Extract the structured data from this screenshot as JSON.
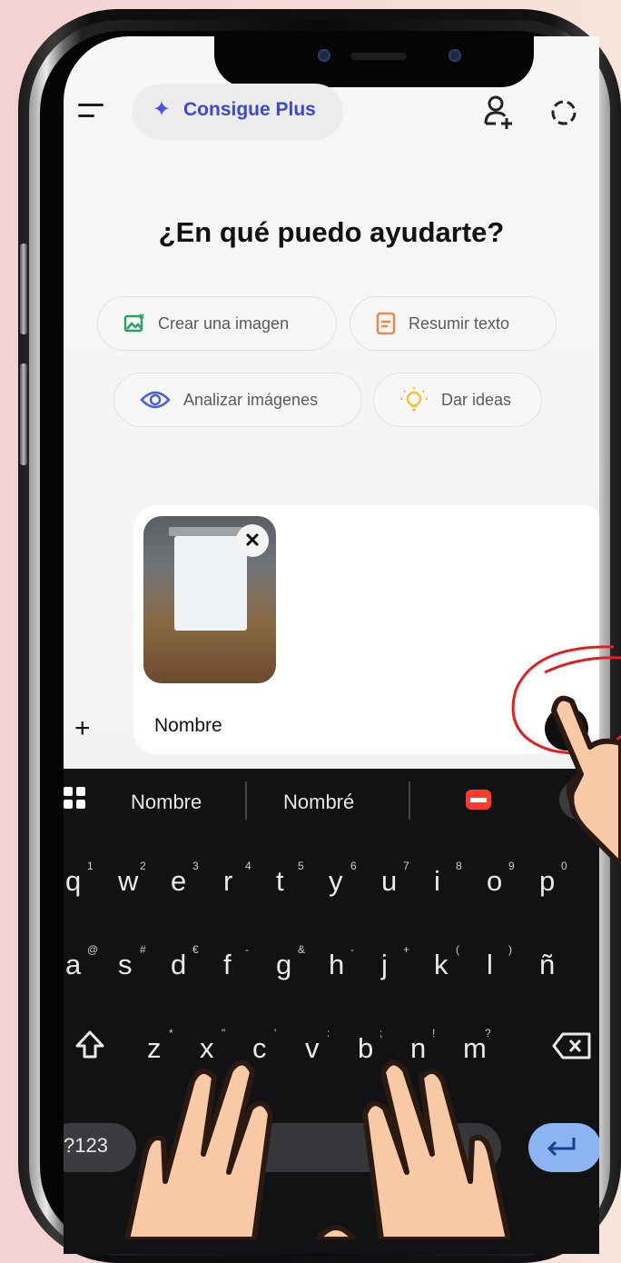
{
  "header": {
    "plus_label": "Consigue Plus",
    "icons": [
      "menu-icon",
      "add-person-icon",
      "dotted-circle-icon"
    ]
  },
  "main": {
    "title": "¿En qué puedo ayudarte?",
    "chips": [
      {
        "label": "Crear una imagen",
        "icon": "image-icon",
        "color": "#2aa06a"
      },
      {
        "label": "Resumir texto",
        "icon": "document-icon",
        "color": "#e8894a"
      },
      {
        "label": "Analizar imágenes",
        "icon": "eye-icon",
        "color": "#4b5fd6"
      },
      {
        "label": "Dar ideas",
        "icon": "lightbulb-icon",
        "color": "#e9c93c"
      }
    ]
  },
  "composer": {
    "text": "Nombre"
  },
  "keyboard": {
    "suggestions": [
      "Nombre",
      "Nombré"
    ],
    "row1": [
      {
        "k": "q",
        "h": "1"
      },
      {
        "k": "w",
        "h": "2"
      },
      {
        "k": "e",
        "h": "3"
      },
      {
        "k": "r",
        "h": "4"
      },
      {
        "k": "t",
        "h": "5"
      },
      {
        "k": "y",
        "h": "6"
      },
      {
        "k": "u",
        "h": "7"
      },
      {
        "k": "i",
        "h": "8"
      },
      {
        "k": "o",
        "h": "9"
      },
      {
        "k": "p",
        "h": "0"
      }
    ],
    "row2": [
      {
        "k": "a",
        "h": "@"
      },
      {
        "k": "s",
        "h": "#"
      },
      {
        "k": "d",
        "h": "€"
      },
      {
        "k": "f",
        "h": "-"
      },
      {
        "k": "g",
        "h": "&"
      },
      {
        "k": "h",
        "h": "-"
      },
      {
        "k": "j",
        "h": "+"
      },
      {
        "k": "k",
        "h": "("
      },
      {
        "k": "l",
        "h": ")"
      },
      {
        "k": "ñ",
        "h": ""
      }
    ],
    "row3": [
      {
        "k": "z",
        "h": "*"
      },
      {
        "k": "x",
        "h": "\""
      },
      {
        "k": "c",
        "h": "'"
      },
      {
        "k": "v",
        "h": ":"
      },
      {
        "k": "b",
        "h": ";"
      },
      {
        "k": "n",
        "h": "!"
      },
      {
        "k": "m",
        "h": "?"
      }
    ],
    "symbols_label": "?123",
    "accent_color": "#8cb4f2"
  }
}
